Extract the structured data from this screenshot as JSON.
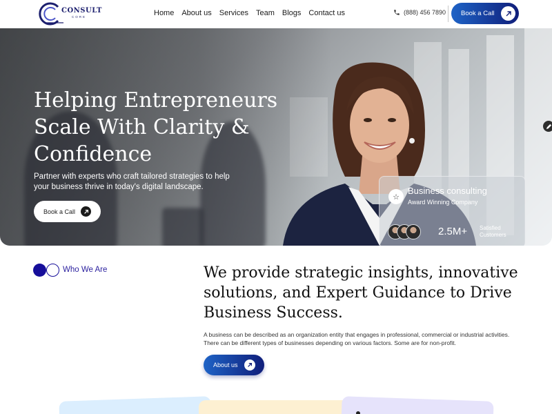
{
  "header": {
    "logo": {
      "main": "CONSULT",
      "sub": "CORE"
    },
    "nav": [
      "Home",
      "About us",
      "Services",
      "Team",
      "Blogs",
      "Contact us"
    ],
    "phone": "(888) 456 7890",
    "cta_label": "Book a Call"
  },
  "hero": {
    "title": "Helping Entrepreneurs Scale With Clarity & Confidence",
    "subtitle": "Partner with experts who craft tailored strategies to help your business thrive in today's digital landscape.",
    "cta_label": "Book a Call",
    "card": {
      "title": "Business consulting",
      "subtitle": "Award Winning Company",
      "stat_value": "2.5M+",
      "stat_label": "Satisfied Customers"
    }
  },
  "about": {
    "tag": "Who We Are",
    "title": "We provide strategic insights, innovative solutions, and Expert Guidance to Drive Business Success.",
    "text": "A business can be described as an organization entity that engages in professional, commercial or industrial activities. There can be different types of businesses depending on various factors. Some are for non-profit.",
    "cta_label": "About us"
  },
  "colors": {
    "brand_dark": "#101e7a",
    "brand_blue": "#1e63c6",
    "accent_indigo": "#160e9a"
  }
}
